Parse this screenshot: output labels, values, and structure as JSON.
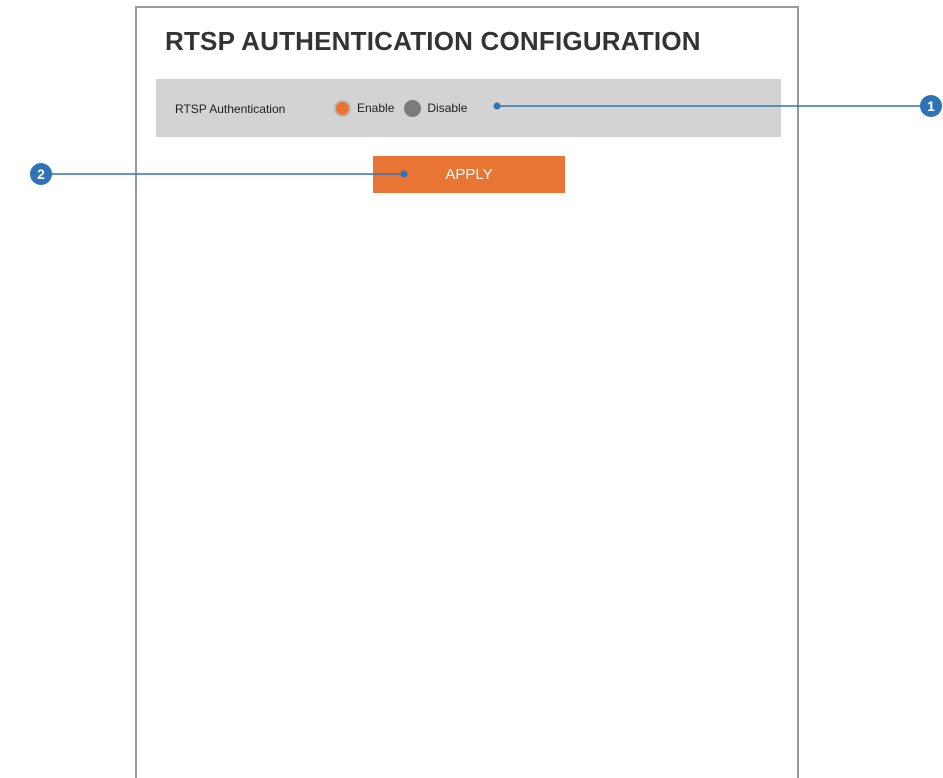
{
  "page": {
    "title": "RTSP AUTHENTICATION CONFIGURATION"
  },
  "rtsp_auth": {
    "label": "RTSP Authentication",
    "options": [
      {
        "label": "Enable",
        "checked": true
      },
      {
        "label": "Disable",
        "checked": false
      }
    ]
  },
  "actions": {
    "apply_label": "APPLY"
  },
  "callouts": [
    {
      "number": "1"
    },
    {
      "number": "2"
    }
  ],
  "colors": {
    "accent": "#e97534",
    "row_background": "#d3d3d4",
    "callout": "#2f73b7",
    "unchecked_radio": "#7b7b7b"
  }
}
